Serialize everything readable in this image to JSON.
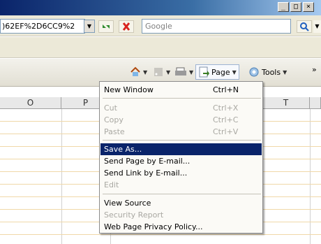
{
  "window": {
    "controls": [
      "_",
      "□",
      "×"
    ]
  },
  "address": {
    "value": ")62EF%2D6CC9%2",
    "dropdown_icon": "chevron-down-icon"
  },
  "search": {
    "placeholder": "Google"
  },
  "command_bar": {
    "page_label": "Page",
    "tools_label": "Tools",
    "more_label": "»"
  },
  "sheet": {
    "columns": [
      "O",
      "P",
      "T"
    ]
  },
  "menu": {
    "items": [
      {
        "label": "New Window",
        "shortcut": "Ctrl+N",
        "disabled": false
      },
      {
        "label": "Cut",
        "shortcut": "Ctrl+X",
        "disabled": true
      },
      {
        "label": "Copy",
        "shortcut": "Ctrl+C",
        "disabled": true
      },
      {
        "label": "Paste",
        "shortcut": "Ctrl+V",
        "disabled": true
      },
      {
        "label": "Save As...",
        "shortcut": "",
        "disabled": false,
        "highlighted": true
      },
      {
        "label": "Send Page by E-mail...",
        "shortcut": "",
        "disabled": false
      },
      {
        "label": "Send Link by E-mail...",
        "shortcut": "",
        "disabled": false
      },
      {
        "label": "Edit",
        "shortcut": "",
        "disabled": true
      },
      {
        "label": "View Source",
        "shortcut": "",
        "disabled": false
      },
      {
        "label": "Security Report",
        "shortcut": "",
        "disabled": true
      },
      {
        "label": "Web Page Privacy Policy...",
        "shortcut": "",
        "disabled": false
      }
    ]
  },
  "colors": {
    "highlight": "#0a246a",
    "disabled_text": "#a9a8a2"
  }
}
